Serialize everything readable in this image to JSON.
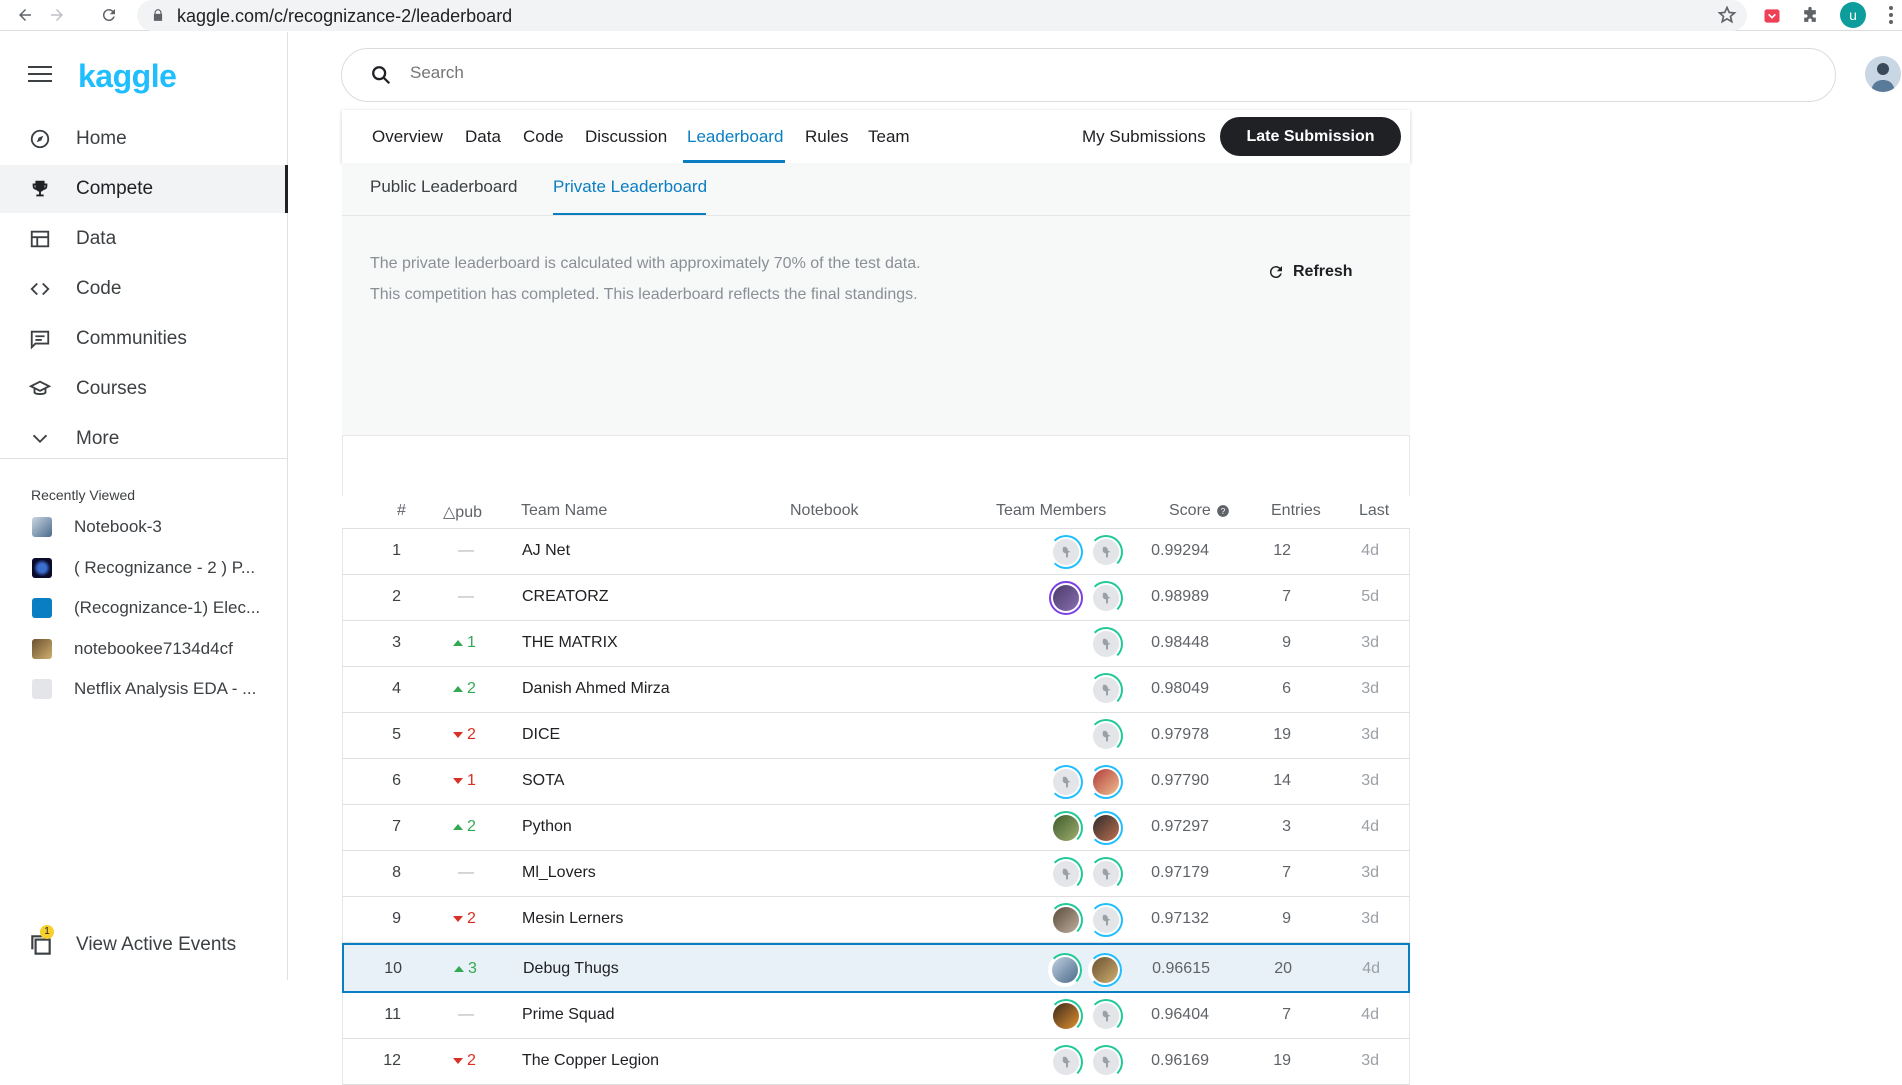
{
  "browser": {
    "url": "kaggle.com/c/recognizance-2/leaderboard",
    "profile_initial": "u"
  },
  "sidebar": {
    "logo": "kaggle",
    "items": [
      {
        "label": "Home",
        "icon": "compass-icon"
      },
      {
        "label": "Compete",
        "icon": "trophy-icon"
      },
      {
        "label": "Data",
        "icon": "table-icon"
      },
      {
        "label": "Code",
        "icon": "code-icon"
      },
      {
        "label": "Communities",
        "icon": "chat-icon"
      },
      {
        "label": "Courses",
        "icon": "graduation-cap-icon"
      },
      {
        "label": "More",
        "icon": "chevron-down-icon"
      }
    ],
    "active_item": "Compete",
    "recently_viewed_title": "Recently Viewed",
    "recent": [
      {
        "label": "Notebook-3"
      },
      {
        "label": "( Recognizance - 2 ) P..."
      },
      {
        "label": "(Recognizance-1) Elec..."
      },
      {
        "label": "notebookee7134d4cf"
      },
      {
        "label": "Netflix Analysis EDA - ..."
      }
    ],
    "events_label": "View Active Events",
    "events_badge": "1"
  },
  "search": {
    "placeholder": "Search"
  },
  "tabs": {
    "items": [
      "Overview",
      "Data",
      "Code",
      "Discussion",
      "Leaderboard",
      "Rules",
      "Team"
    ],
    "active": "Leaderboard",
    "my_submissions": "My Submissions",
    "late_submission": "Late Submission"
  },
  "leaderboard": {
    "subtabs": [
      "Public Leaderboard",
      "Private Leaderboard"
    ],
    "active_subtab": "Private Leaderboard",
    "info_line1": "The private leaderboard is calculated with approximately 70% of the test data.",
    "info_line2": "This competition has completed. This leaderboard reflects the final standings.",
    "refresh_label": "Refresh",
    "headers": {
      "rank": "#",
      "delta": "△pub",
      "team": "Team Name",
      "notebook": "Notebook",
      "members": "Team Members",
      "score": "Score",
      "entries": "Entries",
      "last": "Last"
    },
    "rows": [
      {
        "rank": "1",
        "delta": "—",
        "dir": "none",
        "team": "AJ Net",
        "score": "0.99294",
        "entries": "12",
        "last": "4d"
      },
      {
        "rank": "2",
        "delta": "—",
        "dir": "none",
        "team": "CREATORZ",
        "score": "0.98989",
        "entries": "7",
        "last": "5d"
      },
      {
        "rank": "3",
        "delta": "1",
        "dir": "up",
        "team": "THE MATRIX",
        "score": "0.98448",
        "entries": "9",
        "last": "3d"
      },
      {
        "rank": "4",
        "delta": "2",
        "dir": "up",
        "team": "Danish Ahmed Mirza",
        "score": "0.98049",
        "entries": "6",
        "last": "3d"
      },
      {
        "rank": "5",
        "delta": "2",
        "dir": "down",
        "team": "DICE",
        "score": "0.97978",
        "entries": "19",
        "last": "3d"
      },
      {
        "rank": "6",
        "delta": "1",
        "dir": "down",
        "team": "SOTA",
        "score": "0.97790",
        "entries": "14",
        "last": "3d"
      },
      {
        "rank": "7",
        "delta": "2",
        "dir": "up",
        "team": "Python",
        "score": "0.97297",
        "entries": "3",
        "last": "4d"
      },
      {
        "rank": "8",
        "delta": "—",
        "dir": "none",
        "team": "Ml_Lovers",
        "score": "0.97179",
        "entries": "7",
        "last": "3d"
      },
      {
        "rank": "9",
        "delta": "2",
        "dir": "down",
        "team": "Mesin Lerners",
        "score": "0.97132",
        "entries": "9",
        "last": "3d"
      },
      {
        "rank": "10",
        "delta": "3",
        "dir": "up",
        "team": "Debug Thugs",
        "score": "0.96615",
        "entries": "20",
        "last": "4d",
        "highlighted": true
      },
      {
        "rank": "11",
        "delta": "—",
        "dir": "none",
        "team": "Prime Squad",
        "score": "0.96404",
        "entries": "7",
        "last": "4d"
      },
      {
        "rank": "12",
        "delta": "2",
        "dir": "down",
        "team": "The Copper Legion",
        "score": "0.96169",
        "entries": "19",
        "last": "3d"
      }
    ]
  },
  "colors": {
    "brand": "#20beff",
    "accent": "#0a7ec2",
    "up": "#34a853",
    "down": "#d93025"
  }
}
